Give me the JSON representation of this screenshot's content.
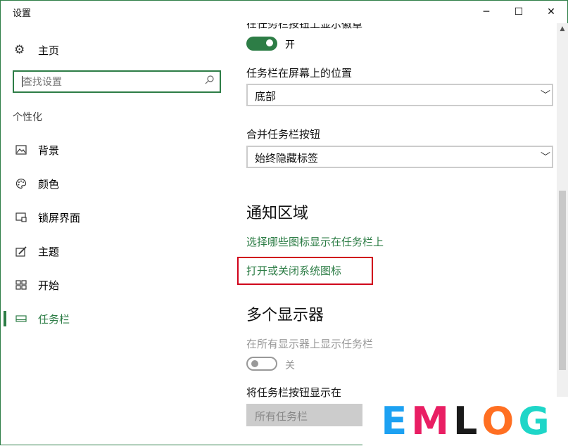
{
  "window": {
    "title": "设置",
    "minimize_glyph": "─",
    "maximize_glyph": "☐",
    "close_glyph": "✕"
  },
  "sidebar": {
    "home_label": "主页",
    "search_placeholder": "查找设置",
    "section_label": "个性化",
    "items": [
      {
        "label": "背景",
        "icon": "picture-icon"
      },
      {
        "label": "颜色",
        "icon": "palette-icon"
      },
      {
        "label": "锁屏界面",
        "icon": "lock-screen-icon"
      },
      {
        "label": "主题",
        "icon": "theme-icon"
      },
      {
        "label": "开始",
        "icon": "start-icon"
      },
      {
        "label": "任务栏",
        "icon": "taskbar-icon",
        "active": true
      }
    ]
  },
  "content": {
    "cut_setting_label": "在任务栏按钮上显示徽章",
    "badge_toggle_state": "开",
    "position_label": "任务栏在屏幕上的位置",
    "position_value": "底部",
    "combine_label": "合并任务栏按钮",
    "combine_value": "始终隐藏标签",
    "notification_heading": "通知区域",
    "link_select_icons": "选择哪些图标显示在任务栏上",
    "link_system_icons": "打开或关闭系统图标",
    "multi_display_heading": "多个显示器",
    "show_all_displays_label": "在所有显示器上显示任务栏",
    "show_all_displays_state": "关",
    "buttons_on_label": "将任务栏按钮显示在",
    "buttons_on_value": "所有任务栏"
  },
  "watermark": {
    "letters": [
      "E",
      "M",
      "L",
      "O",
      "G"
    ],
    "colors": [
      "#1da1f2",
      "#e91e63",
      "#1a1a1a",
      "#ff6f22",
      "#1ed6c8"
    ]
  },
  "colors": {
    "accent": "#2d7d46",
    "highlight_box": "#d0021b"
  }
}
